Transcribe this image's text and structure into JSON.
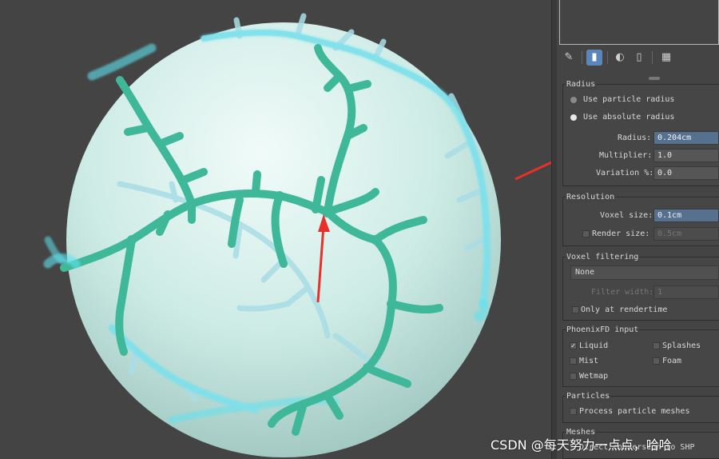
{
  "toolbar": {
    "icons": [
      "pin-icon",
      "modify-icon",
      "instance-icon",
      "trash-icon",
      "configure-icon"
    ]
  },
  "rollouts": {
    "radius": {
      "title": "Radius",
      "use_particle_radius": "Use particle radius",
      "use_absolute_radius": "Use absolute radius",
      "radius_label": "Radius:",
      "radius_value": "0.204cm",
      "multiplier_label": "Multiplier:",
      "multiplier_value": "1.0",
      "variation_label": "Variation %:",
      "variation_value": "0.0"
    },
    "resolution": {
      "title": "Resolution",
      "voxel_size_label": "Voxel size:",
      "voxel_size_value": "0.1cm",
      "render_size_label": "Render size:",
      "render_size_value": "0.5cm"
    },
    "voxel_filtering": {
      "title": "Voxel filtering",
      "mode_value": "None",
      "filter_width_label": "Filter width:",
      "filter_width_value": "1",
      "only_at_rendertime": "Only at rendertime"
    },
    "phoenix_input": {
      "title": "PhoenixFD input",
      "liquid": "Liquid",
      "splashes": "Splashes",
      "mist": "Mist",
      "foam": "Foam",
      "wetmap": "Wetmap"
    },
    "particles": {
      "title": "Particles",
      "process_particle_meshes": "Process particle meshes"
    },
    "meshes": {
      "title": "Meshes",
      "direct_conversion": "Direct conversion to SHP"
    }
  },
  "watermark": "CSDN @每天努力一点点，哈哈",
  "colors": {
    "viewport_bg": "#444444",
    "sphere": "#cfeee8",
    "branches": "#3fb89a",
    "selection_outline": "#5ee3f0",
    "annotation_arrow": "#e8302a",
    "selected_field": "#56708f"
  }
}
